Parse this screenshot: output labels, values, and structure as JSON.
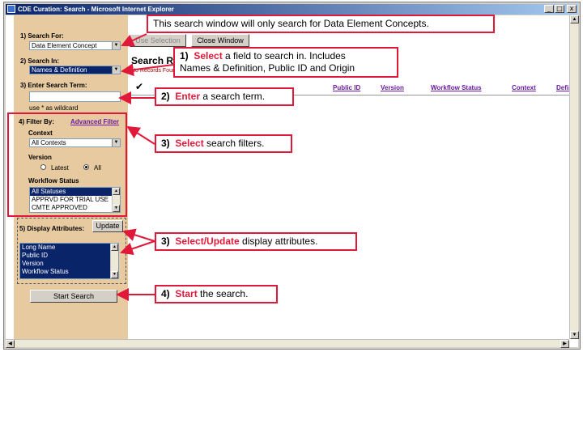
{
  "window": {
    "title": "CDE Curation: Search - Microsoft Internet Explorer",
    "buttons": {
      "minimize": "_",
      "maximize": "□",
      "close": "x"
    }
  },
  "left_panel": {
    "search_for": {
      "label": "1) Search For:",
      "value": "Data Element Concept"
    },
    "search_in": {
      "label": "2) Search In:",
      "value": "Names & Definition"
    },
    "search_term": {
      "label": "3) Enter Search Term:",
      "value": "",
      "hint": "use * as wildcard"
    },
    "filter": {
      "label": "4) Filter By:",
      "advanced_link": "Advanced Filter",
      "context_label": "Context",
      "context_value": "All Contexts",
      "version_label": "Version",
      "version_options": [
        "Latest",
        "All"
      ],
      "version_selected": "All",
      "workflow_label": "Workflow Status",
      "workflow_items": [
        "All Statuses",
        "APPRVD FOR TRIAL USE",
        "CMTE APPROVED"
      ]
    },
    "display": {
      "label": "5) Display Attributes:",
      "update_button": "Update",
      "items": [
        "Long Name",
        "Public ID",
        "Version",
        "Workflow Status"
      ]
    },
    "start_button": "Start Search"
  },
  "toolbar": {
    "use_selection": "Use Selection",
    "close_window": "Close Window"
  },
  "results": {
    "title": "Search Results",
    "no_records": "No Records Found",
    "columns": [
      "Public ID",
      "Version",
      "Workflow Status",
      "Context",
      "Definition"
    ]
  },
  "callouts": {
    "top_note": "This search window will only search for Data Element Concepts.",
    "step1": {
      "num": "1)",
      "verb": "Select",
      "rest": "a field to search in.  Includes",
      "line2": "Names & Definition, Public ID and Origin"
    },
    "step2": {
      "num": "2)",
      "verb": "Enter",
      "rest": "a search term."
    },
    "step3a": {
      "num": "3)",
      "verb": "Select",
      "rest": "search filters."
    },
    "step3b": {
      "num": "3)",
      "verb": "Select/Update",
      "rest": "display attributes."
    },
    "step4": {
      "num": "4)",
      "verb": "Start",
      "rest": "the search."
    }
  },
  "colors": {
    "accent_red": "#e0193a",
    "panel": "#e8caa0",
    "link": "#6a1aa8",
    "selection": "#0a246a"
  }
}
